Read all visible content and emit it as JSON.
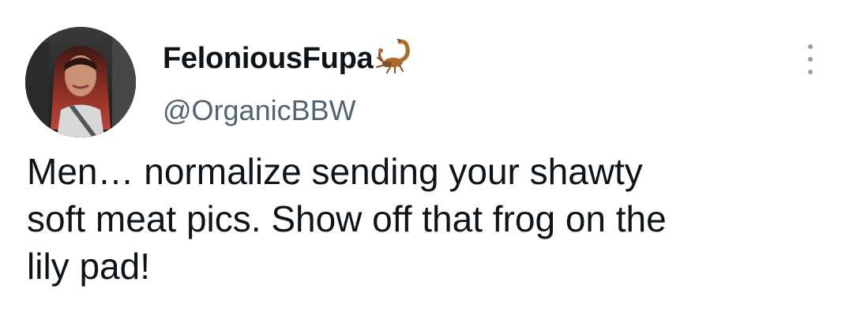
{
  "tweet": {
    "author": {
      "display_name": "FeloniousFupa",
      "handle": "@OrganicBBW",
      "name_emoji": "scorpion-icon"
    },
    "text": "Men… normalize sending your shawty\nsoft meat pics. Show off that frog on the\nlily pad!",
    "more_icon": "more-vertical-icon"
  },
  "colors": {
    "text_primary": "#0f1419",
    "text_secondary": "#536471",
    "menu_dots": "#8fa3b0",
    "background": "#ffffff"
  }
}
